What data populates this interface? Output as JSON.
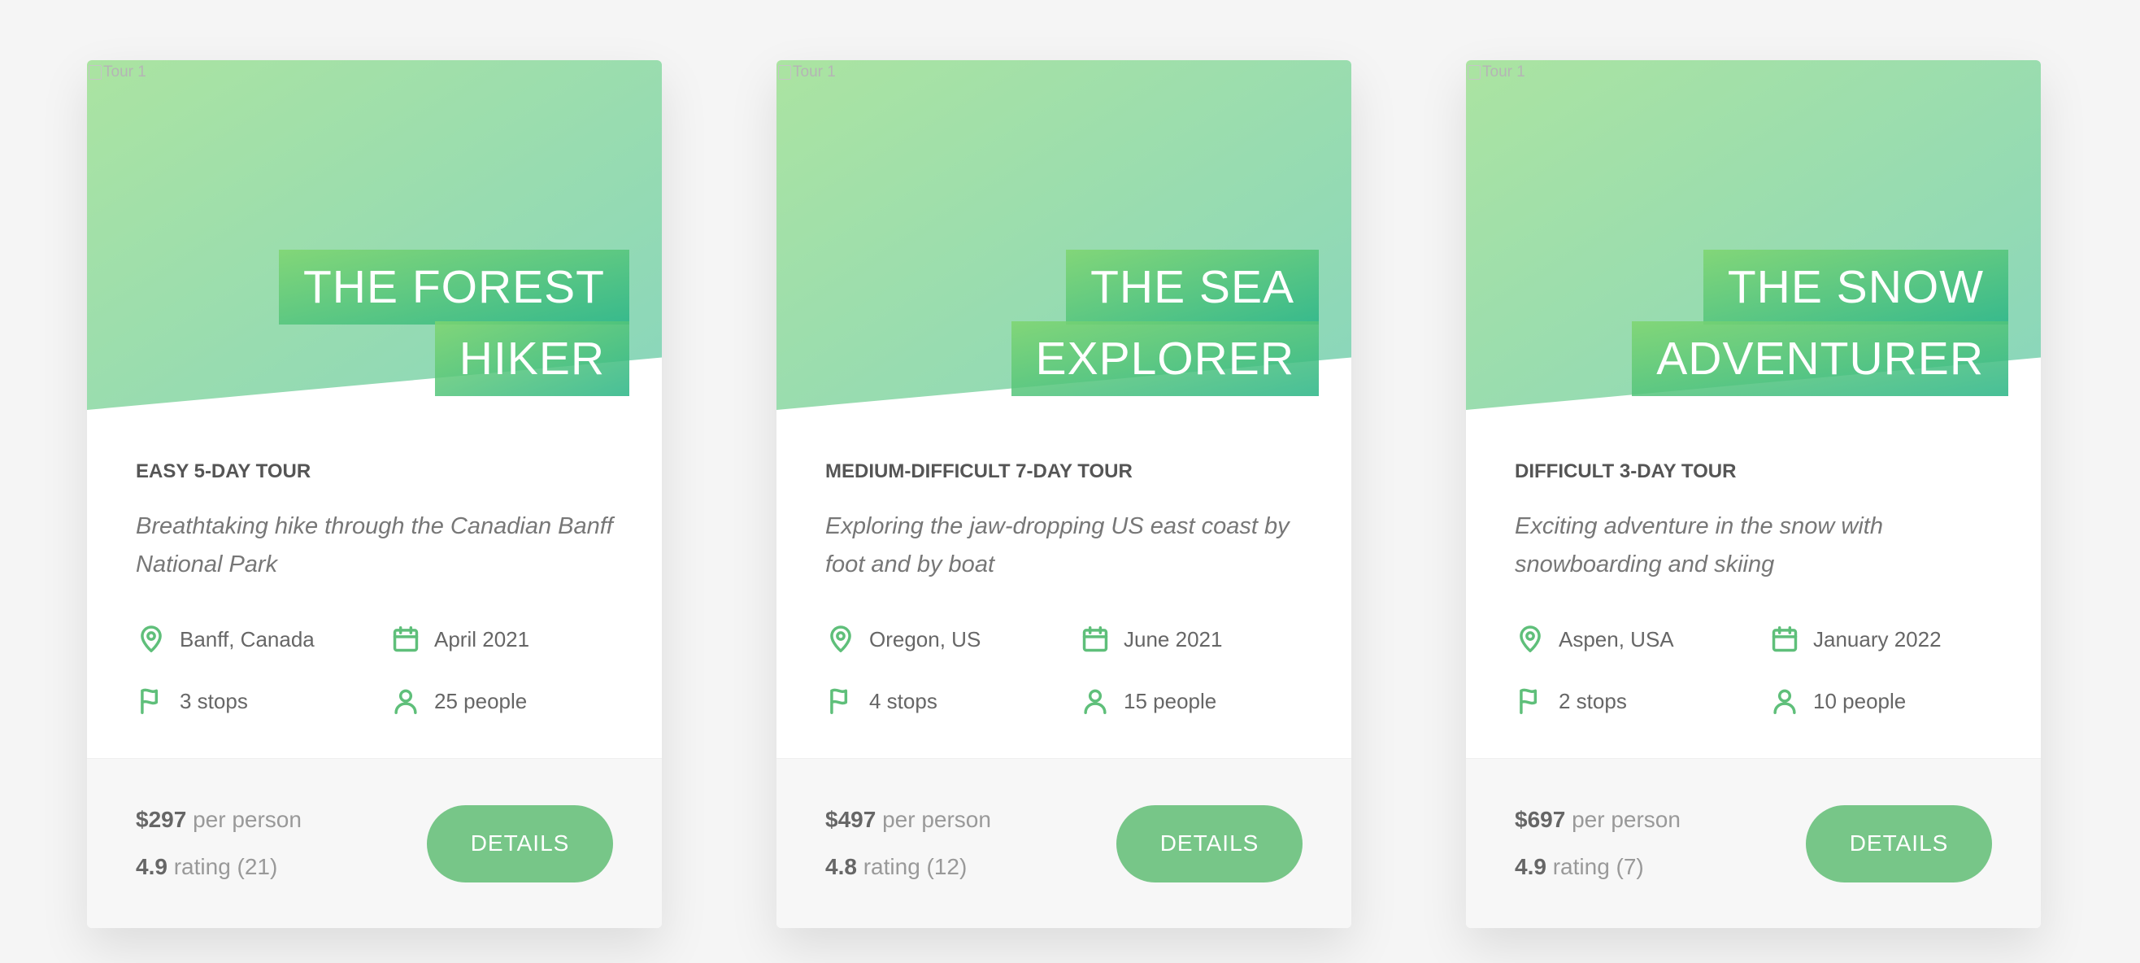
{
  "tours": [
    {
      "image_alt": "Tour 1",
      "heading_line1": "The Forest",
      "heading_line2": "Hiker",
      "sub_heading": "Easy 5-day tour",
      "description": "Breathtaking hike through the Canadian Banff National Park",
      "location": "Banff, Canada",
      "date": "April 2021",
      "stops": "3 stops",
      "people": "25 people",
      "price": "$297",
      "price_unit": "per person",
      "rating": "4.9",
      "rating_label": "rating (21)",
      "button": "Details"
    },
    {
      "image_alt": "Tour 1",
      "heading_line1": "The Sea",
      "heading_line2": "Explorer",
      "sub_heading": "Medium-difficult 7-day tour",
      "description": "Exploring the jaw-dropping US east coast by foot and by boat",
      "location": "Oregon, US",
      "date": "June 2021",
      "stops": "4 stops",
      "people": "15 people",
      "price": "$497",
      "price_unit": "per person",
      "rating": "4.8",
      "rating_label": "rating (12)",
      "button": "Details"
    },
    {
      "image_alt": "Tour 1",
      "heading_line1": "The Snow",
      "heading_line2": "Adventurer",
      "sub_heading": "Difficult 3-day tour",
      "description": "Exciting adventure in the snow with snowboarding and skiing",
      "location": "Aspen, USA",
      "date": "January 2022",
      "stops": "2 stops",
      "people": "10 people",
      "price": "$697",
      "price_unit": "per person",
      "rating": "4.9",
      "rating_label": "rating (7)",
      "button": "Details"
    }
  ],
  "colors": {
    "accent": "#77c688",
    "gradient_light": "#7ed56f",
    "gradient_dark": "#28b485",
    "icon": "#5fbf7a"
  },
  "icons": [
    "map-pin-icon",
    "calendar-icon",
    "flag-icon",
    "user-icon"
  ]
}
